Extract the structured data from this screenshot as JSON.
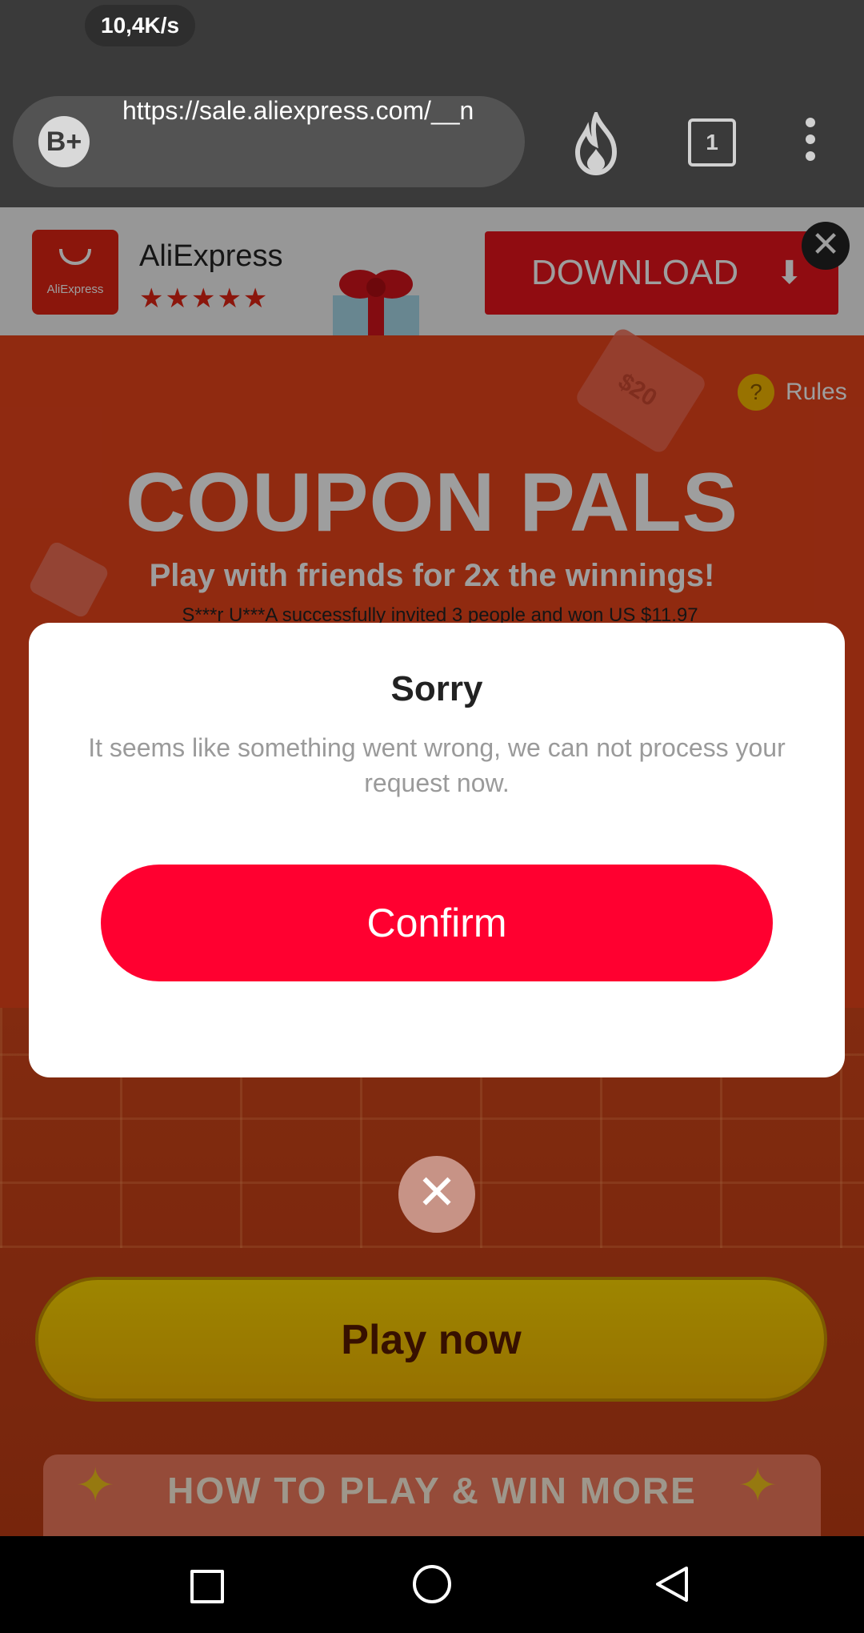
{
  "status_bar": {
    "network_speed": "10,4K/s"
  },
  "browser": {
    "profile_badge": "B+",
    "url": "https://sale.aliexpress.com/__n",
    "tab_count": "1",
    "icons": {
      "hot": "fire-icon",
      "menu": "kebab-menu-icon"
    }
  },
  "app_banner": {
    "logo_text": "AliExpress",
    "name": "AliExpress",
    "rating_stars": "★★★★★",
    "download_label": "DOWNLOAD",
    "download_icon": "⬇",
    "close_icon": "✕"
  },
  "promo": {
    "rules_icon": "?",
    "rules_label": "Rules",
    "ticket_value": "$20",
    "title": "COUPON PALS",
    "subtitle": "Play with friends for 2x the winnings!",
    "ticker": "S***r U***A successfully invited 3 people and won US $11.97",
    "play_label": "Play now",
    "how_to_label": "HOW TO PLAY & WIN MORE",
    "sparkle": "✦"
  },
  "dialog": {
    "title": "Sorry",
    "message": "It seems like something went wrong, we can not process your request now.",
    "confirm_label": "Confirm",
    "close_icon": "✕"
  },
  "colors": {
    "accent_red": "#ff0030",
    "page_orange": "#e8441b",
    "play_yellow": "#ffd800"
  }
}
